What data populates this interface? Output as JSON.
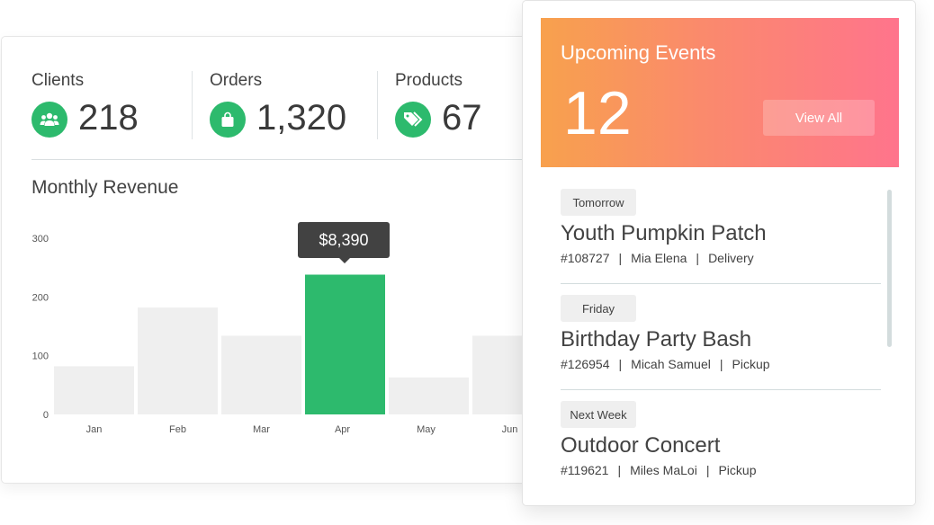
{
  "stats": [
    {
      "label": "Clients",
      "value": "218",
      "icon": "users-icon"
    },
    {
      "label": "Orders",
      "value": "1,320",
      "icon": "shopping-bag-icon"
    },
    {
      "label": "Products",
      "value": "67",
      "icon": "tags-icon"
    }
  ],
  "colors": {
    "accent": "#2dba6d",
    "bar_default": "#efefef",
    "tooltip_bg": "#424242",
    "gradient_start": "#f8a14d",
    "gradient_end": "#ff748c"
  },
  "chart_title": "Monthly Revenue",
  "tooltip": {
    "value": "$8,390"
  },
  "chart_data": {
    "type": "bar",
    "title": "Monthly Revenue",
    "categories": [
      "Jan",
      "Feb",
      "Mar",
      "Apr",
      "May",
      "Jun"
    ],
    "values": [
      82,
      182,
      134,
      238,
      63,
      134
    ],
    "highlighted": "Apr",
    "highlight_label": "$8,390",
    "xlabel": "",
    "ylabel": "",
    "ylim": [
      0,
      300
    ],
    "yticks": [
      0,
      100,
      200,
      300
    ],
    "grid": false,
    "legend": "none"
  },
  "events": {
    "title": "Upcoming Events",
    "count": "12",
    "view_all_label": "View All",
    "items": [
      {
        "when": "Tomorrow",
        "name": "Youth Pumpkin Patch",
        "id": "#108727",
        "person": "Mia Elena",
        "type": "Delivery"
      },
      {
        "when": "Friday",
        "name": "Birthday Party Bash",
        "id": "#126954",
        "person": "Micah Samuel",
        "type": "Pickup"
      },
      {
        "when": "Next Week",
        "name": "Outdoor Concert",
        "id": "#119621",
        "person": "Miles MaLoi",
        "type": "Pickup"
      }
    ]
  }
}
